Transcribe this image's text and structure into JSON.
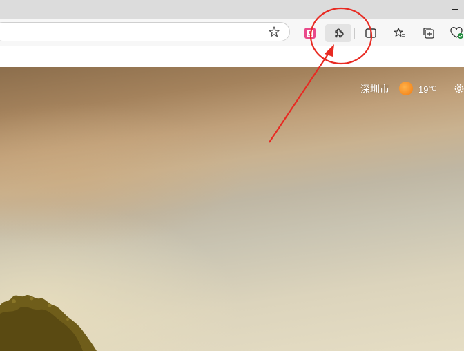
{
  "window": {
    "minimize_label": "–"
  },
  "addressbar": {
    "favorite_icon": "star-icon"
  },
  "toolbar": {
    "icons": [
      "app-icon",
      "extensions-icon",
      "split-screen-icon",
      "favorites-icon",
      "collections-icon",
      "browser-essentials-icon"
    ]
  },
  "weather": {
    "city": "深圳市",
    "temperature": "19",
    "unit": "℃"
  },
  "annotation": {
    "color": "#e82a22"
  }
}
